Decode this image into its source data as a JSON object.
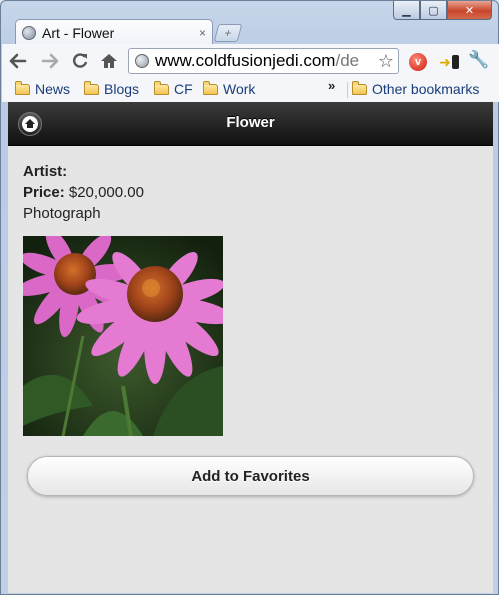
{
  "browser": {
    "tab_title": "Art - Flower",
    "tab_close": "×",
    "new_tab": "+",
    "url_main": "www.coldfusionjedi.com",
    "url_rest": "/de",
    "bookmarks": [
      "News",
      "Blogs",
      "CF",
      "Work"
    ],
    "overflow_glyph": "»",
    "other_bookmarks": "Other bookmarks",
    "window_controls": {
      "minimize": "▁",
      "maximize": "▢",
      "close": "✕"
    },
    "icons": {
      "back": "back-arrow-icon",
      "forward": "forward-arrow-icon",
      "reload": "reload-icon",
      "home": "home-icon",
      "star": "star-icon",
      "wrench": "wrench-icon"
    }
  },
  "app": {
    "header_title": "Flower",
    "artist_label": "Artist:",
    "artist_value": "",
    "price_label": "Price:",
    "price_value": "$20,000.00",
    "medium": "Photograph",
    "favorite_button": "Add to Favorites"
  },
  "colors": {
    "header_bg": "#1a1a1a",
    "page_bg": "#e5e5e5",
    "flower_petal": "#e070c8",
    "flower_center": "#b5541a"
  }
}
